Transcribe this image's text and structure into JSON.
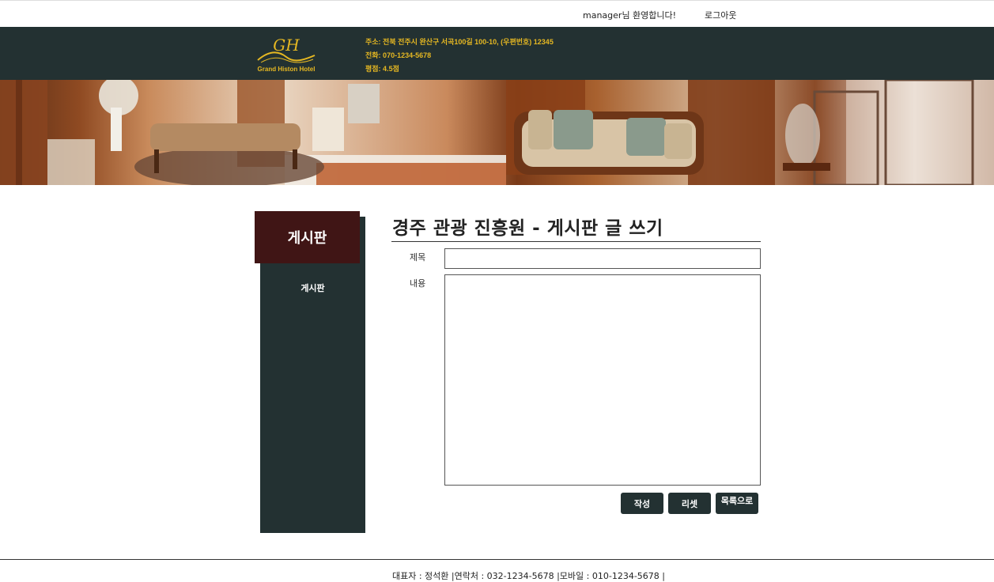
{
  "topbar": {
    "welcome_text": "manager님 환영합니다!",
    "logout_label": "로그아웃"
  },
  "header": {
    "logo_monogram": "GH",
    "logo_text": "Grand Histon Hotel",
    "address": "주소: 전북 전주시 완산구 서곡100길 100-10, (우편번호) 12345",
    "phone": "전화: 070-1234-5678",
    "rating": "평점: 4.5점"
  },
  "sidebar": {
    "title": "게시판",
    "items": [
      {
        "label": "게시판"
      }
    ]
  },
  "main": {
    "title": "경주 관광 진흥원 - 게시판 글 쓰기",
    "form": {
      "title_label": "제목",
      "title_value": "",
      "content_label": "내용",
      "content_value": ""
    },
    "buttons": {
      "submit_label": "작성",
      "reset_label": "리셋",
      "list_label": "목록으로"
    }
  },
  "footer": {
    "text": "대표자 : 정석환 |연락처 : 032-1234-5678 |모바일 : 010-1234-5678 |"
  },
  "colors": {
    "header_bg": "#233132",
    "accent_gold": "#e6b822",
    "sidebar_title_bg": "#401515"
  }
}
